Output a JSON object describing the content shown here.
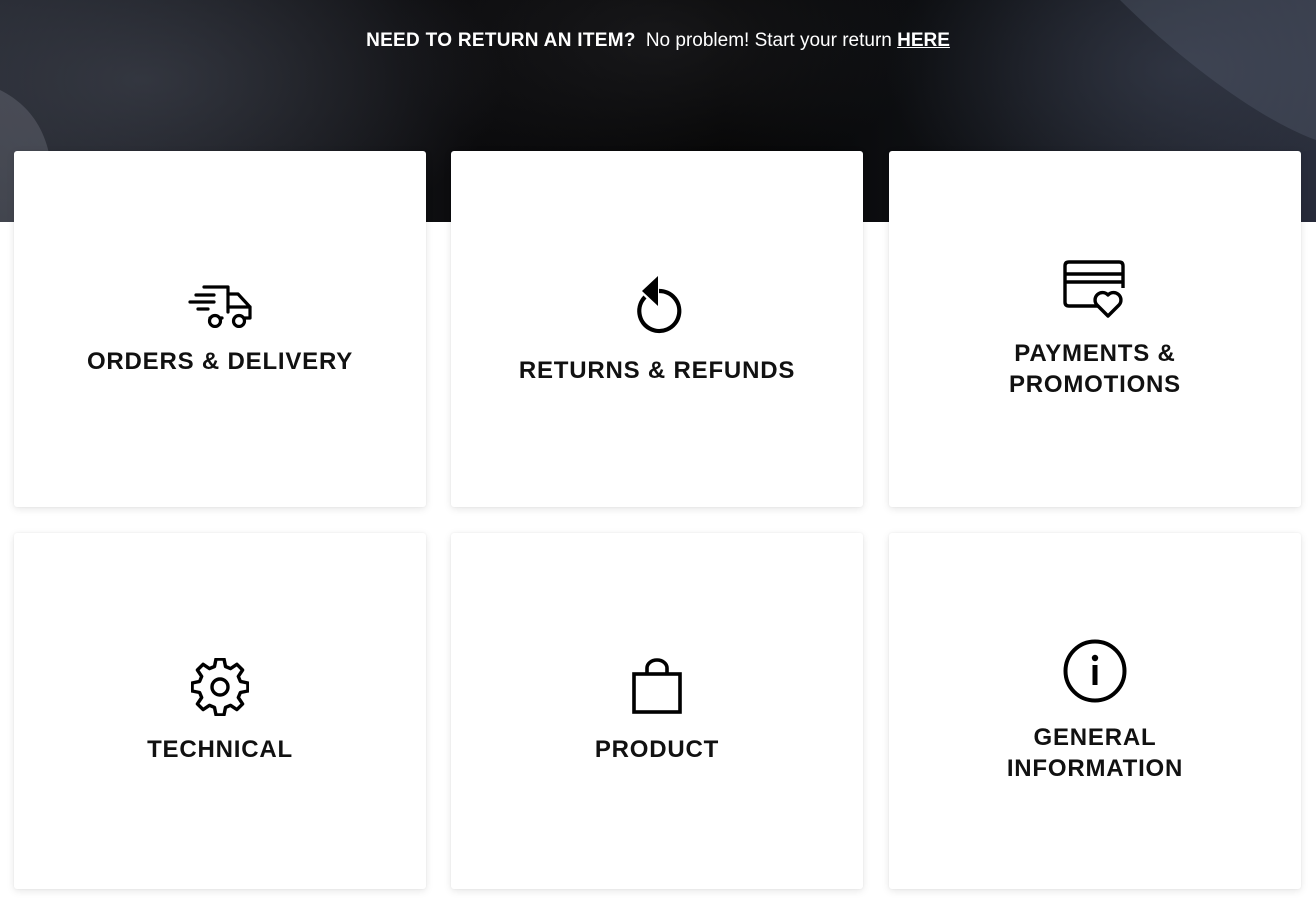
{
  "banner": {
    "heading": "NEED TO RETURN AN ITEM?",
    "message": "No problem! Start your return",
    "link_text": "HERE"
  },
  "categories": [
    {
      "label": "ORDERS & DELIVERY",
      "icon": "delivery-truck-icon"
    },
    {
      "label": "RETURNS & REFUNDS",
      "icon": "return-arrow-icon"
    },
    {
      "label": "PAYMENTS &\nPROMOTIONS",
      "icon": "credit-card-heart-icon"
    },
    {
      "label": "TECHNICAL",
      "icon": "gear-icon"
    },
    {
      "label": "PRODUCT",
      "icon": "shopping-bag-icon"
    },
    {
      "label": "GENERAL\nINFORMATION",
      "icon": "info-icon"
    }
  ],
  "colors": {
    "text": "#111111",
    "card_background": "#ffffff",
    "hero_background": "#050505"
  }
}
